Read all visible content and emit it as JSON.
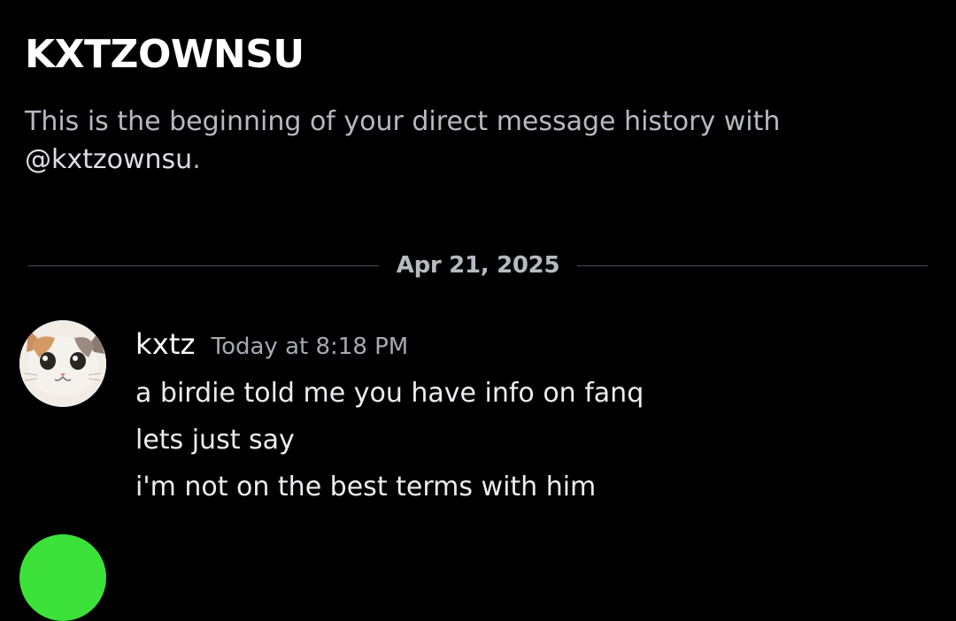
{
  "header": {
    "title": "KXTZOWNSU",
    "intro_prefix": "This is the beginning of your direct message history with",
    "intro_mention": "@kxtzownsu",
    "intro_suffix": "."
  },
  "divider": {
    "date": "Apr 21, 2025"
  },
  "message": {
    "avatar_icon": "cat-avatar-icon",
    "username": "kxtz",
    "timestamp": "Today at 8:18 PM",
    "lines": [
      "a birdie told me you have info on fanq",
      "lets just say",
      "i'm not on the best terms with him"
    ]
  },
  "next_message": {
    "avatar_color": "#3ce13a"
  },
  "colors": {
    "background": "#000000",
    "muted_text": "#b5bac1",
    "divider_line": "#4e5058"
  }
}
